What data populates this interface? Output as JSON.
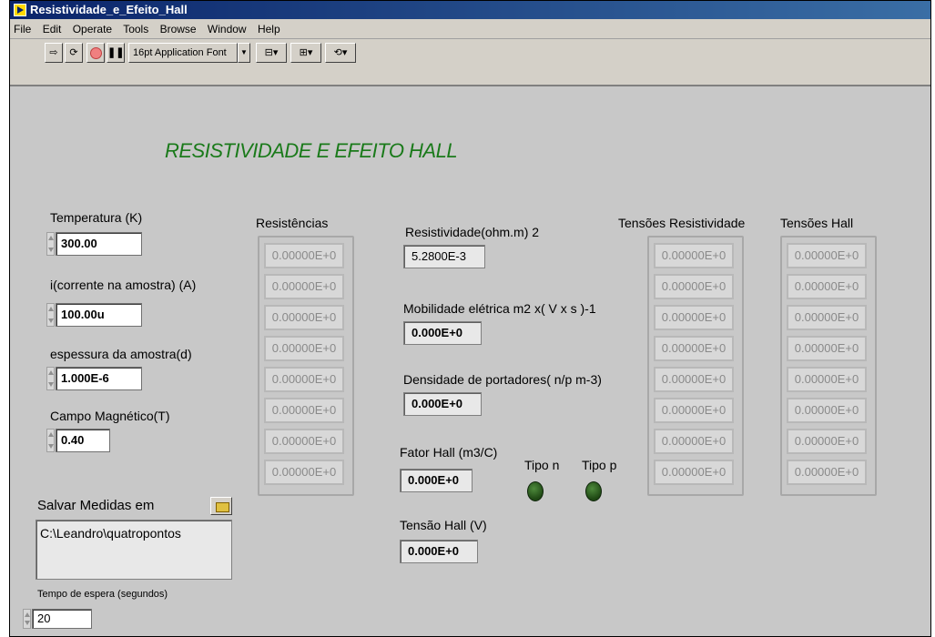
{
  "window": {
    "title": "Resistividade_e_Efeito_Hall"
  },
  "menu": [
    "File",
    "Edit",
    "Operate",
    "Tools",
    "Browse",
    "Window",
    "Help"
  ],
  "toolbar": {
    "font_label": "16pt Application Font"
  },
  "heading": "RESISTIVIDADE E EFEITO HALL",
  "inputs": {
    "temperatura": {
      "label": "Temperatura (K)",
      "value": "300.00"
    },
    "corrente": {
      "label": "i(corrente na amostra) (A)",
      "value": "100.00u"
    },
    "espessura": {
      "label": "espessura da amostra(d)",
      "value": "1.000E-6"
    },
    "campo": {
      "label": "Campo Magnético(T)",
      "value": "0.40"
    }
  },
  "salvar": {
    "label": "Salvar  Medidas em",
    "path": "C:\\Leandro\\quatropontos"
  },
  "espera": {
    "label": "Tempo de espera (segundos)",
    "value": "20"
  },
  "resistencias": {
    "label": "Resistências",
    "values": [
      "0.00000E+0",
      "0.00000E+0",
      "0.00000E+0",
      "0.00000E+0",
      "0.00000E+0",
      "0.00000E+0",
      "0.00000E+0",
      "0.00000E+0"
    ]
  },
  "resistividade": {
    "label": "Resistividade(ohm.m) 2",
    "value": "5.2800E-3"
  },
  "mobilidade": {
    "label": "Mobilidade elétrica m2 x( V x s )-1",
    "value": "0.000E+0"
  },
  "densidade": {
    "label": "Densidade de portadores(  n/p m-3)",
    "value": "0.000E+0"
  },
  "fator_hall": {
    "label": "Fator Hall (m3/C)",
    "value": "0.000E+0"
  },
  "tensao_hall": {
    "label": "Tensão Hall (V)",
    "value": "0.000E+0"
  },
  "tipo_n": {
    "label": "Tipo n"
  },
  "tipo_p": {
    "label": "Tipo p"
  },
  "tensoes_resistividade": {
    "label": "Tensões Resistividade",
    "values": [
      "0.00000E+0",
      "0.00000E+0",
      "0.00000E+0",
      "0.00000E+0",
      "0.00000E+0",
      "0.00000E+0",
      "0.00000E+0",
      "0.00000E+0"
    ]
  },
  "tensoes_hall": {
    "label": "Tensões Hall",
    "values": [
      "0.00000E+0",
      "0.00000E+0",
      "0.00000E+0",
      "0.00000E+0",
      "0.00000E+0",
      "0.00000E+0",
      "0.00000E+0",
      "0.00000E+0"
    ]
  },
  "colors": {
    "heading": "#1a7a1a",
    "led": "#2f6a22",
    "panel": "#c8c8c8"
  },
  "icons": [
    "run-arrow-icon",
    "run-continuous-icon",
    "abort-icon",
    "pause-icon",
    "align-icon",
    "distribute-icon",
    "reorder-icon",
    "folder-icon",
    "led-indicator"
  ]
}
